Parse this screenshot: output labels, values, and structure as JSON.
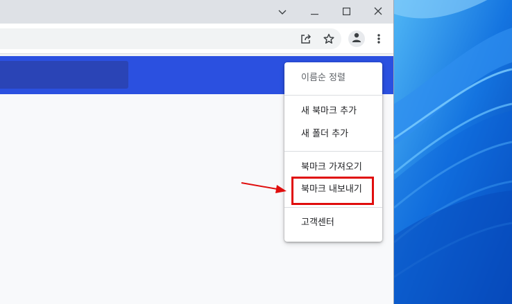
{
  "window_controls": {
    "dropdown_icon": "chevron-down-icon",
    "minimize_icon": "minimize-icon",
    "maximize_icon": "maximize-icon",
    "close_icon": "close-icon"
  },
  "toolbar": {
    "share_icon": "share-icon",
    "bookmark_icon": "star-icon",
    "profile_icon": "avatar-icon",
    "menu_icon": "more-vertical-icon"
  },
  "bookmark_menu": {
    "sort": {
      "label": "이름순 정렬"
    },
    "add_bookmark": {
      "label": "새 북마크 추가"
    },
    "add_folder": {
      "label": "새 폴더 추가"
    },
    "import": {
      "label": "북마크 가져오기"
    },
    "export": {
      "label": "북마크 내보내기"
    },
    "help": {
      "label": "고객센터"
    }
  },
  "annotation": {
    "highlight_color": "#e00d0d",
    "arrow_color": "#e00d0d",
    "target": "북마크 내보내기"
  },
  "colors": {
    "page_header": "#2b50e0",
    "search_box": "#2a44b6",
    "wallpaper": "#0a4ec4"
  }
}
